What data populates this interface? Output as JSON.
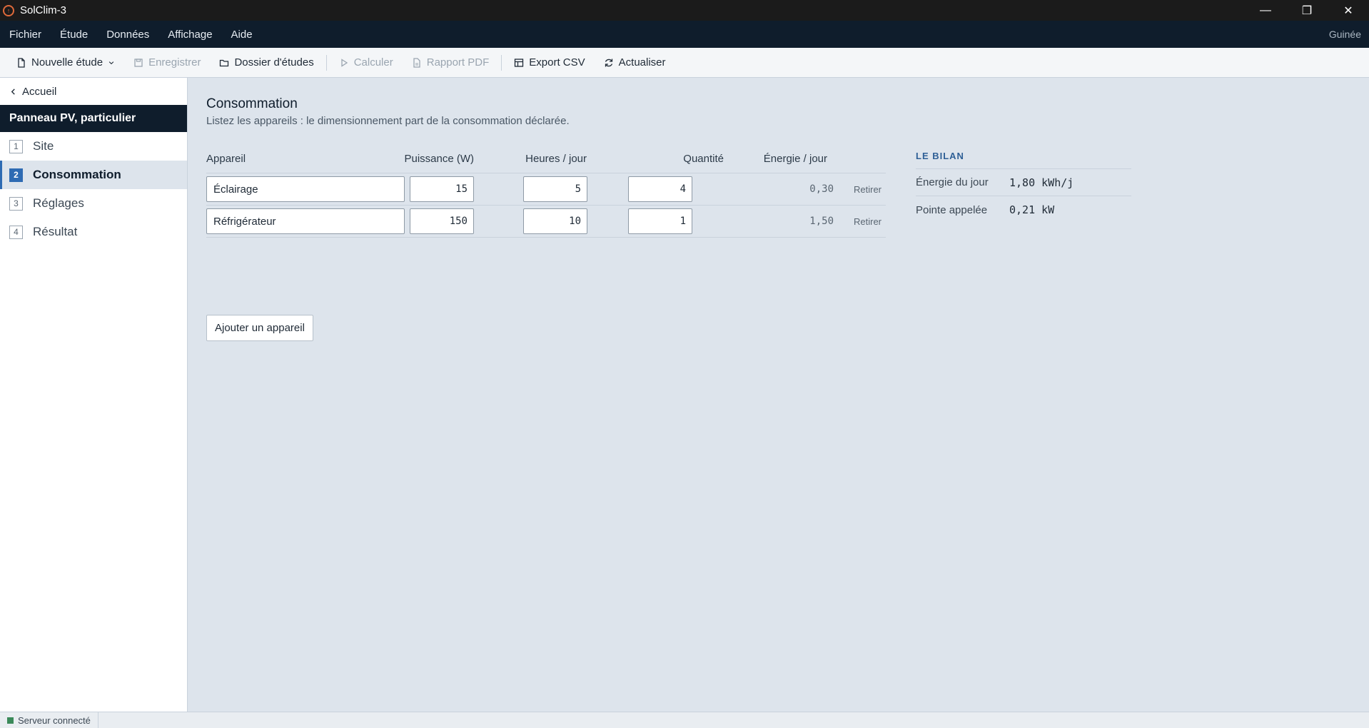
{
  "window": {
    "title": "SolClim-3",
    "controls": {
      "minimize": "—",
      "maximize": "❐",
      "close": "✕"
    }
  },
  "menubar": {
    "items": [
      "Fichier",
      "Étude",
      "Données",
      "Affichage",
      "Aide"
    ],
    "region": "Guinée"
  },
  "toolbar": {
    "new_study": "Nouvelle étude",
    "save": "Enregistrer",
    "studies_folder": "Dossier d'études",
    "calculate": "Calculer",
    "pdf_report": "Rapport PDF",
    "export_csv": "Export CSV",
    "refresh": "Actualiser"
  },
  "sidebar": {
    "back_label": "Accueil",
    "project_title": "Panneau PV, particulier",
    "steps": [
      {
        "num": "1",
        "label": "Site",
        "active": false
      },
      {
        "num": "2",
        "label": "Consommation",
        "active": true
      },
      {
        "num": "3",
        "label": "Réglages",
        "active": false
      },
      {
        "num": "4",
        "label": "Résultat",
        "active": false
      }
    ]
  },
  "main": {
    "title": "Consommation",
    "subtitle": "Listez les appareils : le dimensionnement part de la consommation déclarée.",
    "columns": {
      "device": "Appareil",
      "power": "Puissance (W)",
      "hours": "Heures / jour",
      "quantity": "Quantité",
      "energy": "Énergie / jour"
    },
    "rows": [
      {
        "device": "Éclairage",
        "power": "15",
        "hours": "5",
        "quantity": "4",
        "energy": "0,30",
        "remove": "Retirer"
      },
      {
        "device": "Réfrigérateur",
        "power": "150",
        "hours": "10",
        "quantity": "1",
        "energy": "1,50",
        "remove": "Retirer"
      }
    ],
    "add_button": "Ajouter un appareil"
  },
  "summary": {
    "title": "LE BILAN",
    "daily_energy_label": "Énergie du jour",
    "daily_energy_value": "1,80 kWh/j",
    "peak_label": "Pointe appelée",
    "peak_value": "0,21 kW"
  },
  "statusbar": {
    "server_status": "Serveur connecté"
  }
}
